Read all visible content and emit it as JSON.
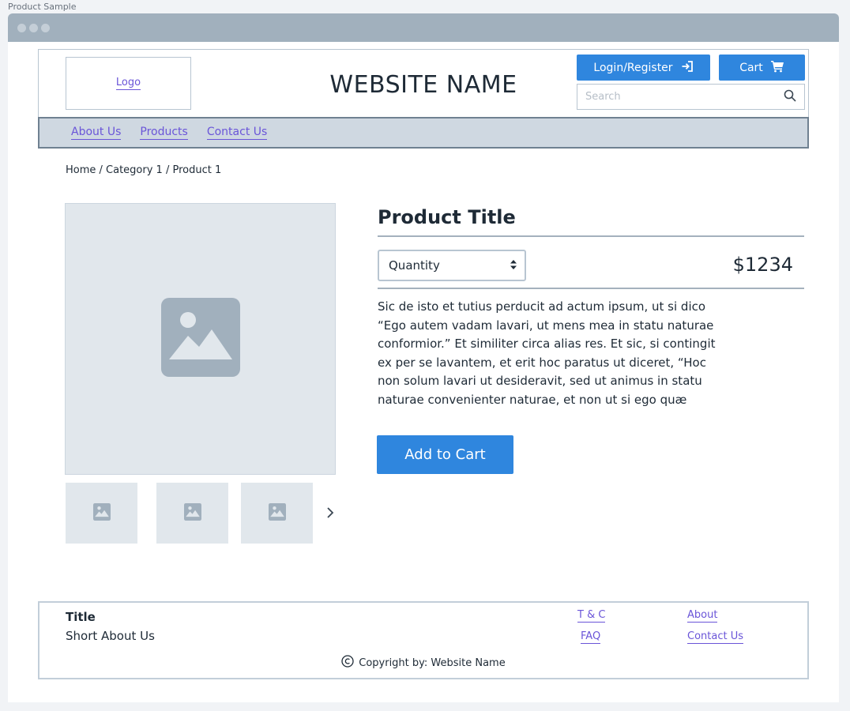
{
  "frame": {
    "label": "Product Sample"
  },
  "header": {
    "logo_label": "Logo",
    "site_name": "WEBSITE NAME",
    "login_label": "Login/Register",
    "cart_label": "Cart",
    "search_placeholder": "Search"
  },
  "nav": {
    "items": [
      {
        "label": "About Us"
      },
      {
        "label": "Products"
      },
      {
        "label": "Contact Us"
      }
    ]
  },
  "breadcrumb": {
    "text": "Home / Category 1 / Product 1"
  },
  "product": {
    "title": "Product Title",
    "quantity_label": "Quantity",
    "price": "$1234",
    "description": "Sic de isto et tutius perducit ad actum ipsum, ut si dico “Ego autem vadam lavari, ut mens mea in statu naturae conformior.” Et similiter circa alias res. Et sic, si contingit ex per se lavantem, et erit hoc paratus ut diceret, “Hoc non solum lavari ut desideravit, sed ut animus in statu naturae convenienter naturae, et non ut si ego quæ",
    "add_to_cart_label": "Add to Cart"
  },
  "icons": {
    "login": "login-arrow-icon",
    "cart": "cart-icon",
    "search": "search-icon",
    "image": "image-placeholder-icon",
    "next": "chevron-right-icon",
    "select": "select-arrows-icon",
    "copyright": "copyright-icon"
  },
  "colors": {
    "accent": "#2f86de",
    "link": "#6a55d8",
    "nav_bg": "#cfd8e1"
  },
  "footer": {
    "title": "Title",
    "about": "Short About Us",
    "links": [
      {
        "label": "T & C"
      },
      {
        "label": "FAQ"
      },
      {
        "label": "About"
      },
      {
        "label": "Contact Us"
      }
    ],
    "copyright": "Copyright by: Website Name"
  }
}
